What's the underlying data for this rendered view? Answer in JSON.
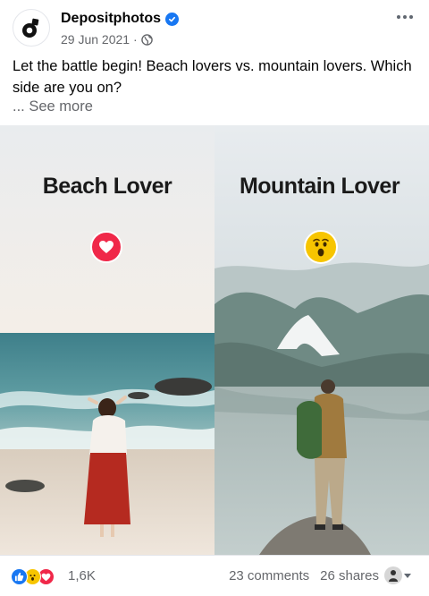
{
  "post": {
    "author": "Depositphotos",
    "date": "29 Jun 2021 ·",
    "text": "Let the battle begin! Beach lovers vs. mountain lovers. Which side are you on?",
    "see_more": "... See more"
  },
  "media": {
    "left_label": "Beach Lover",
    "right_label": "Mountain Lover",
    "left_reaction_icon": "heart-icon",
    "right_reaction_icon": "wow-icon"
  },
  "footer": {
    "reaction_count": "1,6K",
    "comments": "23 comments",
    "shares": "26 shares"
  },
  "colors": {
    "brand_blue": "#1877f2",
    "love_red": "#f02849",
    "wow_yellow": "#f7c500",
    "secondary_text": "#65676b"
  }
}
